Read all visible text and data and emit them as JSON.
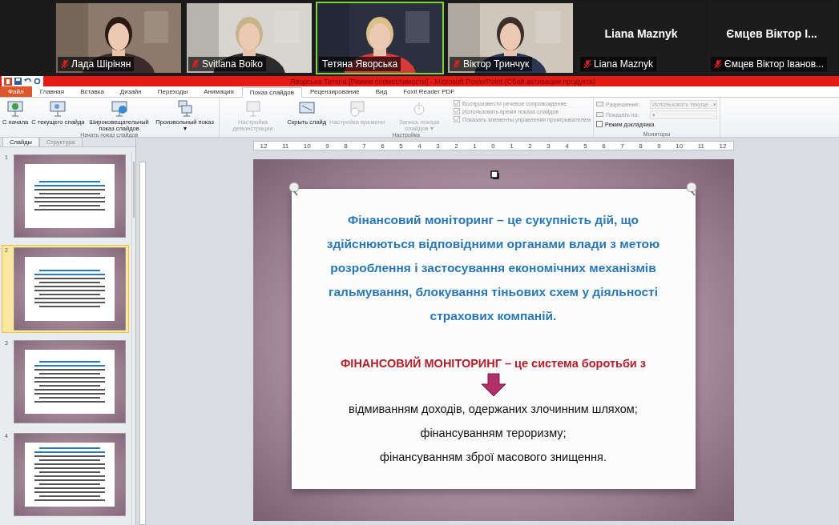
{
  "participants": [
    {
      "name": "Лада Шірінян",
      "muted": true,
      "speaking": false
    },
    {
      "name": "Svitlana Boiko",
      "muted": true,
      "speaking": false
    },
    {
      "name": "Тетяна Яворська",
      "muted": false,
      "speaking": true
    },
    {
      "name": "Віктор Тринчук",
      "muted": true,
      "speaking": false
    },
    {
      "name": "Liana Maznyk",
      "muted": true,
      "speaking": false,
      "display_name": "Liana Maznyk"
    },
    {
      "name": "Ємцев Віктор Іванов...",
      "muted": true,
      "speaking": false,
      "display_name": "Ємцев Віктор І..."
    }
  ],
  "window": {
    "title": "Яворська Тетяна [Режим совместимости] - Microsoft PowerPoint (Сбой активации продукта)"
  },
  "ribbon_tabs": [
    {
      "label": "Файл",
      "kind": "file",
      "selected": false
    },
    {
      "label": "Главная",
      "kind": "tab",
      "selected": false
    },
    {
      "label": "Вставка",
      "kind": "tab",
      "selected": false
    },
    {
      "label": "Дизайн",
      "kind": "tab",
      "selected": false
    },
    {
      "label": "Переходы",
      "kind": "tab",
      "selected": false
    },
    {
      "label": "Анимация",
      "kind": "tab",
      "selected": false
    },
    {
      "label": "Показ слайдов",
      "kind": "tab",
      "selected": true
    },
    {
      "label": "Рецензирование",
      "kind": "tab",
      "selected": false
    },
    {
      "label": "Вид",
      "kind": "tab",
      "selected": false
    },
    {
      "label": "Foxit Reader PDF",
      "kind": "tab",
      "selected": false
    }
  ],
  "ribbon_groups": [
    {
      "title": "Начать показ слайдов",
      "items": [
        {
          "kind": "button",
          "label": "С начала",
          "disabled": false
        },
        {
          "kind": "button",
          "label": "С текущего слайда",
          "disabled": false
        },
        {
          "kind": "button",
          "label": "Широковещательный показ слайдов",
          "disabled": false
        },
        {
          "kind": "button",
          "label": "Произвольный показ",
          "disabled": false,
          "arrow": "▾"
        }
      ]
    },
    {
      "title": "Настройка",
      "items": [
        {
          "kind": "button",
          "label": "Настройка демонстрации",
          "disabled": true
        },
        {
          "kind": "button",
          "label": "Скрыть слайд",
          "disabled": false
        },
        {
          "kind": "button",
          "label": "Настройка времени",
          "disabled": true
        },
        {
          "kind": "button",
          "label": "Запись показа слайдов",
          "disabled": true,
          "arrow": "▾"
        },
        {
          "kind": "checkbox",
          "label": "Воспроизвести речевое сопровождение",
          "checked": true,
          "disabled": true
        },
        {
          "kind": "checkbox",
          "label": "Использовать время показа слайдов",
          "checked": true,
          "disabled": true
        },
        {
          "kind": "checkbox",
          "label": "Показать элементы управления проигрывателем",
          "checked": true,
          "disabled": true
        }
      ]
    },
    {
      "title": "Мониторы",
      "items": [
        {
          "kind": "select",
          "label": "Разрешение:",
          "value": "Использовать текуще...",
          "arrow": "▾",
          "disabled": true
        },
        {
          "kind": "select",
          "label": "Показать на:",
          "arrow": "▾",
          "disabled": true
        },
        {
          "kind": "checkbox",
          "label": "Режим докладчика",
          "checked": false,
          "disabled": false
        }
      ]
    }
  ],
  "slides_panel": {
    "tabs": [
      {
        "label": "Слайды",
        "selected": true
      },
      {
        "label": "Структура",
        "selected": false
      }
    ],
    "thumbnails": [
      {
        "number": "1",
        "selected": false
      },
      {
        "number": "2",
        "selected": true
      },
      {
        "number": "3",
        "selected": false
      },
      {
        "number": "4",
        "selected": false
      }
    ]
  },
  "ruler_labels": [
    "12",
    "11",
    "10",
    "9",
    "8",
    "7",
    "6",
    "5",
    "4",
    "3",
    "2",
    "1",
    "0",
    "1",
    "2",
    "3",
    "4",
    "5",
    "6",
    "7",
    "8",
    "9",
    "10",
    "11",
    "12"
  ],
  "slide": {
    "definition": "Фінансовий моніторинг – це сукупність дій, що здійснюються відповідними органами влади з метою розроблення і застосування економічних механізмів гальмування, блокування тіньових схем у діяльності страхових компаній.",
    "heading": "ФІНАНСОВИЙ МОНІТОРИНГ – це система боротьби з",
    "items": [
      "відмиванням доходів, одержаних злочинним шляхом;",
      "фінансуванням тероризму;",
      "фінансуванням зброї масового знищення."
    ]
  }
}
